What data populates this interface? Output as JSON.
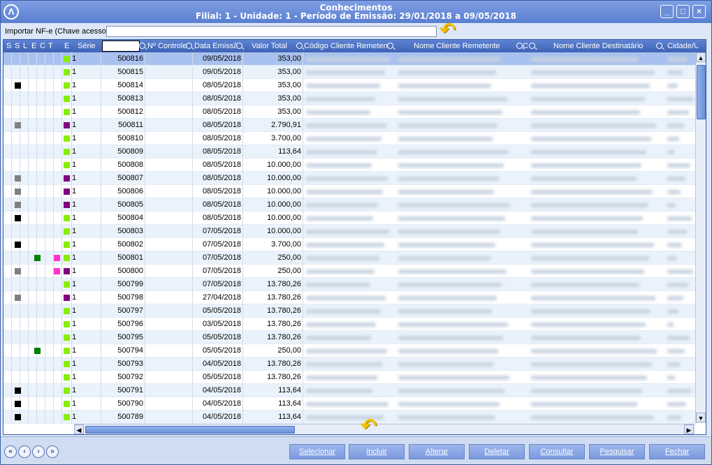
{
  "window": {
    "title": "Conhecimentos",
    "subtitle": "Filial: 1 - Unidade: 1 - Período de Emissão: 29/01/2018 a 09/05/2018",
    "controls": [
      "_",
      "□",
      "×"
    ]
  },
  "import": {
    "label": "Importar NF-e (Chave acesso):",
    "value": ""
  },
  "grid": {
    "flag_headers": [
      "S",
      "S",
      "L",
      "E",
      "C",
      "T",
      "E"
    ],
    "columns": {
      "serie": "Série",
      "controle": "Nº Controle",
      "data": "Data Emissão",
      "valor": "Valor Total",
      "codigo_rem": "Código Cliente Remetente",
      "nome_rem": "Nome Cliente Remetente",
      "c": "C",
      "nome_dest": "Nome Cliente Destinatário",
      "cidade": "Cidade/U"
    },
    "colors": {
      "black": "#000000",
      "gray": "#808080",
      "green_dark": "#008000",
      "magenta": "#ff33cc",
      "green": "#88ee00",
      "purple": "#800080"
    },
    "rows": [
      {
        "s": "",
        "l": "",
        "c": "",
        "e": "green",
        "serie": "1",
        "controle": "500816",
        "data": "09/05/2018",
        "valor": "353,00"
      },
      {
        "s": "",
        "l": "",
        "c": "",
        "e": "green",
        "serie": "1",
        "controle": "500815",
        "data": "09/05/2018",
        "valor": "353,00"
      },
      {
        "s": "black",
        "l": "",
        "c": "",
        "e": "green",
        "serie": "1",
        "controle": "500814",
        "data": "08/05/2018",
        "valor": "353,00"
      },
      {
        "s": "",
        "l": "",
        "c": "",
        "e": "green",
        "serie": "1",
        "controle": "500813",
        "data": "08/05/2018",
        "valor": "353,00"
      },
      {
        "s": "",
        "l": "",
        "c": "",
        "e": "green",
        "serie": "1",
        "controle": "500812",
        "data": "08/05/2018",
        "valor": "353,00"
      },
      {
        "s": "gray",
        "l": "",
        "c": "",
        "e": "purple",
        "serie": "1",
        "controle": "500811",
        "data": "08/05/2018",
        "valor": "2.790,91"
      },
      {
        "s": "",
        "l": "",
        "c": "",
        "e": "green",
        "serie": "1",
        "controle": "500810",
        "data": "08/05/2018",
        "valor": "3.700,00"
      },
      {
        "s": "",
        "l": "",
        "c": "",
        "e": "green",
        "serie": "1",
        "controle": "500809",
        "data": "08/05/2018",
        "valor": "113,64"
      },
      {
        "s": "",
        "l": "",
        "c": "",
        "e": "green",
        "serie": "1",
        "controle": "500808",
        "data": "08/05/2018",
        "valor": "10.000,00"
      },
      {
        "s": "gray",
        "l": "",
        "c": "",
        "e": "purple",
        "serie": "1",
        "controle": "500807",
        "data": "08/05/2018",
        "valor": "10.000,00"
      },
      {
        "s": "gray",
        "l": "",
        "c": "",
        "e": "purple",
        "serie": "1",
        "controle": "500806",
        "data": "08/05/2018",
        "valor": "10.000,00"
      },
      {
        "s": "gray",
        "l": "",
        "c": "",
        "e": "purple",
        "serie": "1",
        "controle": "500805",
        "data": "08/05/2018",
        "valor": "10.000,00"
      },
      {
        "s": "black",
        "l": "",
        "c": "",
        "e": "green",
        "serie": "1",
        "controle": "500804",
        "data": "08/05/2018",
        "valor": "10.000,00"
      },
      {
        "s": "",
        "l": "",
        "c": "",
        "e": "green",
        "serie": "1",
        "controle": "500803",
        "data": "07/05/2018",
        "valor": "10.000,00"
      },
      {
        "s": "black",
        "l": "",
        "c": "",
        "e": "green",
        "serie": "1",
        "controle": "500802",
        "data": "07/05/2018",
        "valor": "3.700,00"
      },
      {
        "s": "",
        "l": "green_dark",
        "c": "magenta",
        "e": "green",
        "serie": "1",
        "controle": "500801",
        "data": "07/05/2018",
        "valor": "250,00"
      },
      {
        "s": "gray",
        "l": "",
        "c": "magenta",
        "e": "purple",
        "serie": "1",
        "controle": "500800",
        "data": "07/05/2018",
        "valor": "250,00"
      },
      {
        "s": "",
        "l": "",
        "c": "",
        "e": "green",
        "serie": "1",
        "controle": "500799",
        "data": "07/05/2018",
        "valor": "13.780,26"
      },
      {
        "s": "gray",
        "l": "",
        "c": "",
        "e": "purple",
        "serie": "1",
        "controle": "500798",
        "data": "27/04/2018",
        "valor": "13.780,26"
      },
      {
        "s": "",
        "l": "",
        "c": "",
        "e": "green",
        "serie": "1",
        "controle": "500797",
        "data": "05/05/2018",
        "valor": "13.780,26"
      },
      {
        "s": "",
        "l": "",
        "c": "",
        "e": "green",
        "serie": "1",
        "controle": "500796",
        "data": "03/05/2018",
        "valor": "13.780,26"
      },
      {
        "s": "",
        "l": "",
        "c": "",
        "e": "green",
        "serie": "1",
        "controle": "500795",
        "data": "05/05/2018",
        "valor": "13.780,26"
      },
      {
        "s": "",
        "l": "green_dark",
        "c": "",
        "e": "green",
        "serie": "1",
        "controle": "500794",
        "data": "05/05/2018",
        "valor": "250,00"
      },
      {
        "s": "",
        "l": "",
        "c": "",
        "e": "green",
        "serie": "1",
        "controle": "500793",
        "data": "04/05/2018",
        "valor": "13.780,26"
      },
      {
        "s": "",
        "l": "",
        "c": "",
        "e": "green",
        "serie": "1",
        "controle": "500792",
        "data": "05/05/2018",
        "valor": "13.780,26"
      },
      {
        "s": "black",
        "l": "",
        "c": "",
        "e": "green",
        "serie": "1",
        "controle": "500791",
        "data": "04/05/2018",
        "valor": "113,64"
      },
      {
        "s": "black",
        "l": "",
        "c": "",
        "e": "green",
        "serie": "1",
        "controle": "500790",
        "data": "04/05/2018",
        "valor": "113,64"
      },
      {
        "s": "black",
        "l": "",
        "c": "",
        "e": "green",
        "serie": "1",
        "controle": "500789",
        "data": "04/05/2018",
        "valor": "113,64"
      }
    ]
  },
  "nav": [
    "«",
    "‹",
    "›",
    "»"
  ],
  "actions": {
    "selecionar": "Selecionar",
    "incluir": "Incluir",
    "alterar": "Alterar",
    "deletar": "Deletar",
    "consultar": "Consultar",
    "pesquisar": "Pesquisar",
    "fechar": "Fechar"
  }
}
